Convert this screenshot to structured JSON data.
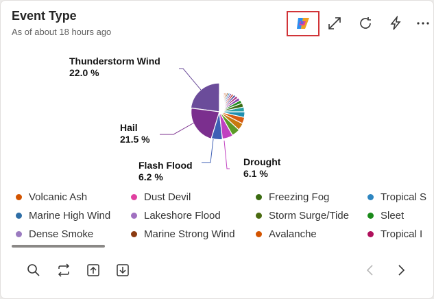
{
  "header": {
    "title": "Event Type",
    "subtitle": "As of about 18 hours ago",
    "icons": [
      "copilot-icon",
      "expand-icon",
      "refresh-icon",
      "lightning-icon",
      "more-icon"
    ]
  },
  "chart_data": {
    "type": "pie",
    "labels": [
      {
        "name": "Thunderstorm Wind",
        "value": "22.0 %"
      },
      {
        "name": "Hail",
        "value": "21.5 %"
      },
      {
        "name": "Flash Flood",
        "value": "6.2 %"
      },
      {
        "name": "Drought",
        "value": "6.1 %"
      }
    ],
    "slices": [
      {
        "value": 22.0,
        "color": "#6b4c9a"
      },
      {
        "value": 21.5,
        "color": "#7b2f8e"
      },
      {
        "value": 6.2,
        "color": "#3e5fb5"
      },
      {
        "value": 6.1,
        "color": "#c040c0"
      },
      {
        "value": 4.8,
        "color": "#5c9a28"
      },
      {
        "value": 4.2,
        "color": "#c87a10"
      },
      {
        "value": 3.8,
        "color": "#d85c10"
      },
      {
        "value": 3.4,
        "color": "#1f8fb0"
      },
      {
        "value": 3.0,
        "color": "#2aa1a5"
      },
      {
        "value": 2.6,
        "color": "#3a6b10"
      },
      {
        "value": 2.2,
        "color": "#228b22"
      },
      {
        "value": 2.0,
        "color": "#8e44ad"
      },
      {
        "value": 1.8,
        "color": "#b03a8a"
      },
      {
        "value": 1.6,
        "color": "#4b4b9b"
      },
      {
        "value": 1.4,
        "color": "#c0392b"
      },
      {
        "value": 1.3,
        "color": "#7d3c98"
      },
      {
        "value": 1.2,
        "color": "#2e86c1"
      },
      {
        "value": 1.1,
        "color": "#8b4513"
      },
      {
        "value": 1.0,
        "color": "#a04000"
      },
      {
        "value": 0.9,
        "color": "#d35400"
      },
      {
        "value": 0.8,
        "color": "#c71585"
      },
      {
        "value": 0.7,
        "color": "#9b59b6"
      },
      {
        "value": 0.6,
        "color": "#e67e22"
      },
      {
        "value": 0.5,
        "color": "#16a085"
      },
      {
        "value": 0.4,
        "color": "#884ea0"
      },
      {
        "value": 0.35,
        "color": "#aa3366"
      },
      {
        "value": 0.3,
        "color": "#c0392b"
      },
      {
        "value": 0.25,
        "color": "#5d6d7e"
      }
    ]
  },
  "legend": {
    "items": [
      {
        "label": "Volcanic Ash",
        "color": "#d35400"
      },
      {
        "label": "Dust Devil",
        "color": "#e040a0"
      },
      {
        "label": "Freezing Fog",
        "color": "#3a6b10"
      },
      {
        "label": "Tropical S",
        "color": "#2e86c1"
      },
      {
        "label": "Marine High Wind",
        "color": "#2e6ea6"
      },
      {
        "label": "Lakeshore Flood",
        "color": "#a070c0"
      },
      {
        "label": "Storm Surge/Tide",
        "color": "#4a6b10"
      },
      {
        "label": "Sleet",
        "color": "#1a8a1a"
      },
      {
        "label": "Dense Smoke",
        "color": "#9b7bc0"
      },
      {
        "label": "Marine Strong Wind",
        "color": "#8b3a10"
      },
      {
        "label": "Avalanche",
        "color": "#d35400"
      },
      {
        "label": "Tropical I",
        "color": "#b0105c"
      }
    ]
  },
  "footer": {
    "icons": [
      "search-icon",
      "swap-icon",
      "export-up-icon",
      "download-icon",
      "chevron-left-icon",
      "chevron-right-icon"
    ]
  }
}
